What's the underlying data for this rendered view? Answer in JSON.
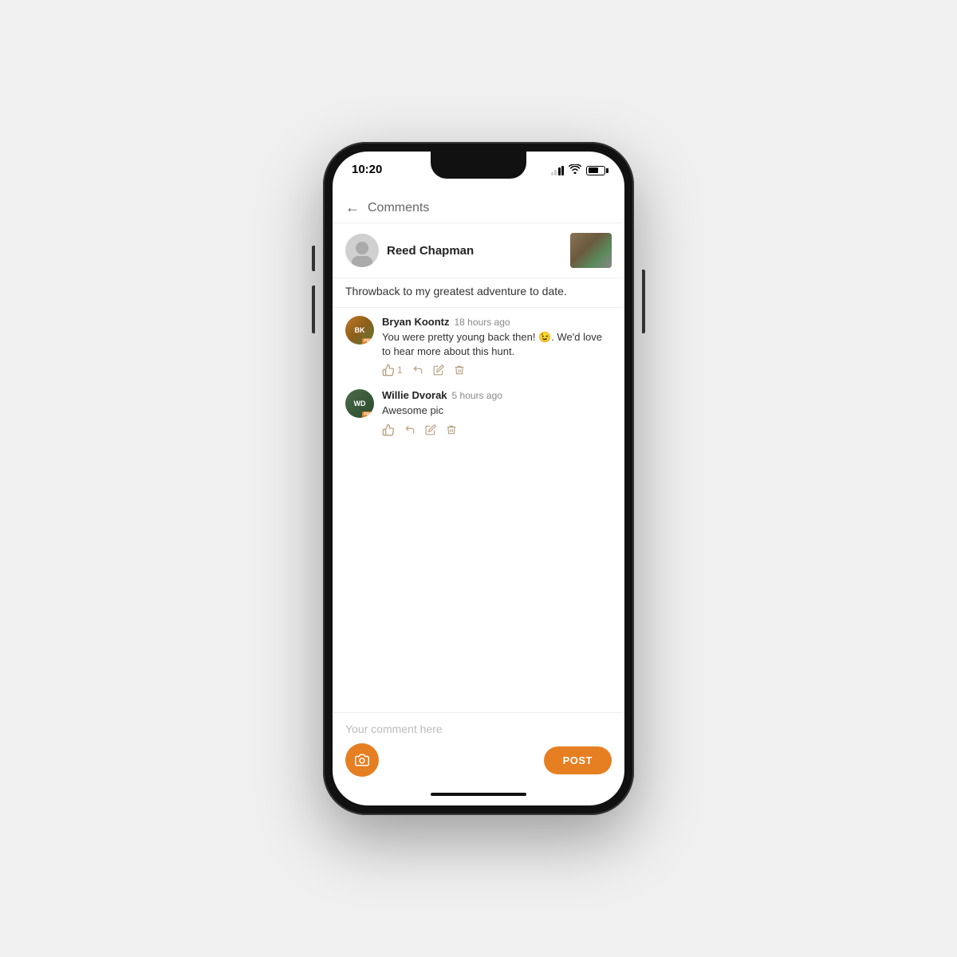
{
  "phone": {
    "time": "10:20"
  },
  "nav": {
    "back_label": "←",
    "title": "Comments"
  },
  "post": {
    "author": "Reed Chapman",
    "caption": "Throwback to my greatest adventure to date."
  },
  "comments": [
    {
      "id": "comment-1",
      "author": "Bryan Koontz",
      "time": "18 hours ago",
      "text": "You were pretty young back then! 😉. We'd love to hear more about this hunt.",
      "likes": "1",
      "avatar_label": "BK",
      "avatar_badge": "PRO"
    },
    {
      "id": "comment-2",
      "author": "Willie Dvorak",
      "time": "5 hours ago",
      "text": "Awesome pic",
      "likes": "",
      "avatar_label": "WD",
      "avatar_badge": "PRO"
    }
  ],
  "input": {
    "placeholder": "Your comment here"
  },
  "buttons": {
    "post_label": "POST"
  },
  "icons": {
    "back": "←",
    "camera": "📷",
    "thumb_up": "👍",
    "reply": "↩",
    "edit": "✏",
    "delete": "🗑"
  }
}
